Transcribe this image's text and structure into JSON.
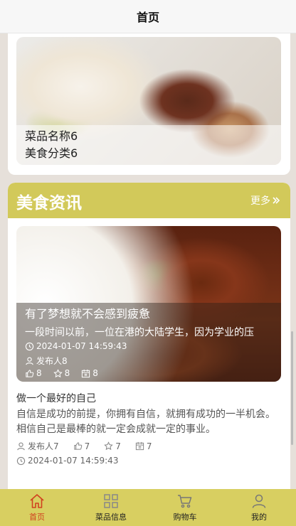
{
  "header": {
    "title": "首页"
  },
  "top_card": {
    "name": "菜品名称6",
    "category": "美食分类6"
  },
  "news": {
    "heading": "美食资讯",
    "more_label": "更多",
    "featured": {
      "title": "有了梦想就不会感到疲惫",
      "summary": "一段时间以前，一位在港的大陆学生，因为学业的压",
      "time": "2024-01-07 14:59:43",
      "author": "发布人8",
      "likes": "8",
      "favorites": "8",
      "views": "8"
    },
    "item": {
      "title": "做一个最好的自己",
      "summary": "自信是成功的前提，你拥有自信，就拥有成功的一半机会。相信自己是最棒的就一定会成就一定的事业。",
      "author": "发布人7",
      "likes": "7",
      "favorites": "7",
      "views": "7",
      "time": "2024-01-07 14:59:43"
    }
  },
  "tabs": [
    {
      "label": "首页",
      "icon": "home-icon"
    },
    {
      "label": "菜品信息",
      "icon": "grid-icon"
    },
    {
      "label": "购物车",
      "icon": "cart-icon"
    },
    {
      "label": "我的",
      "icon": "user-icon"
    }
  ],
  "colors": {
    "accent": "#d2c95a",
    "active_tab": "#d1411f",
    "tabbar": "#d8cf61"
  }
}
